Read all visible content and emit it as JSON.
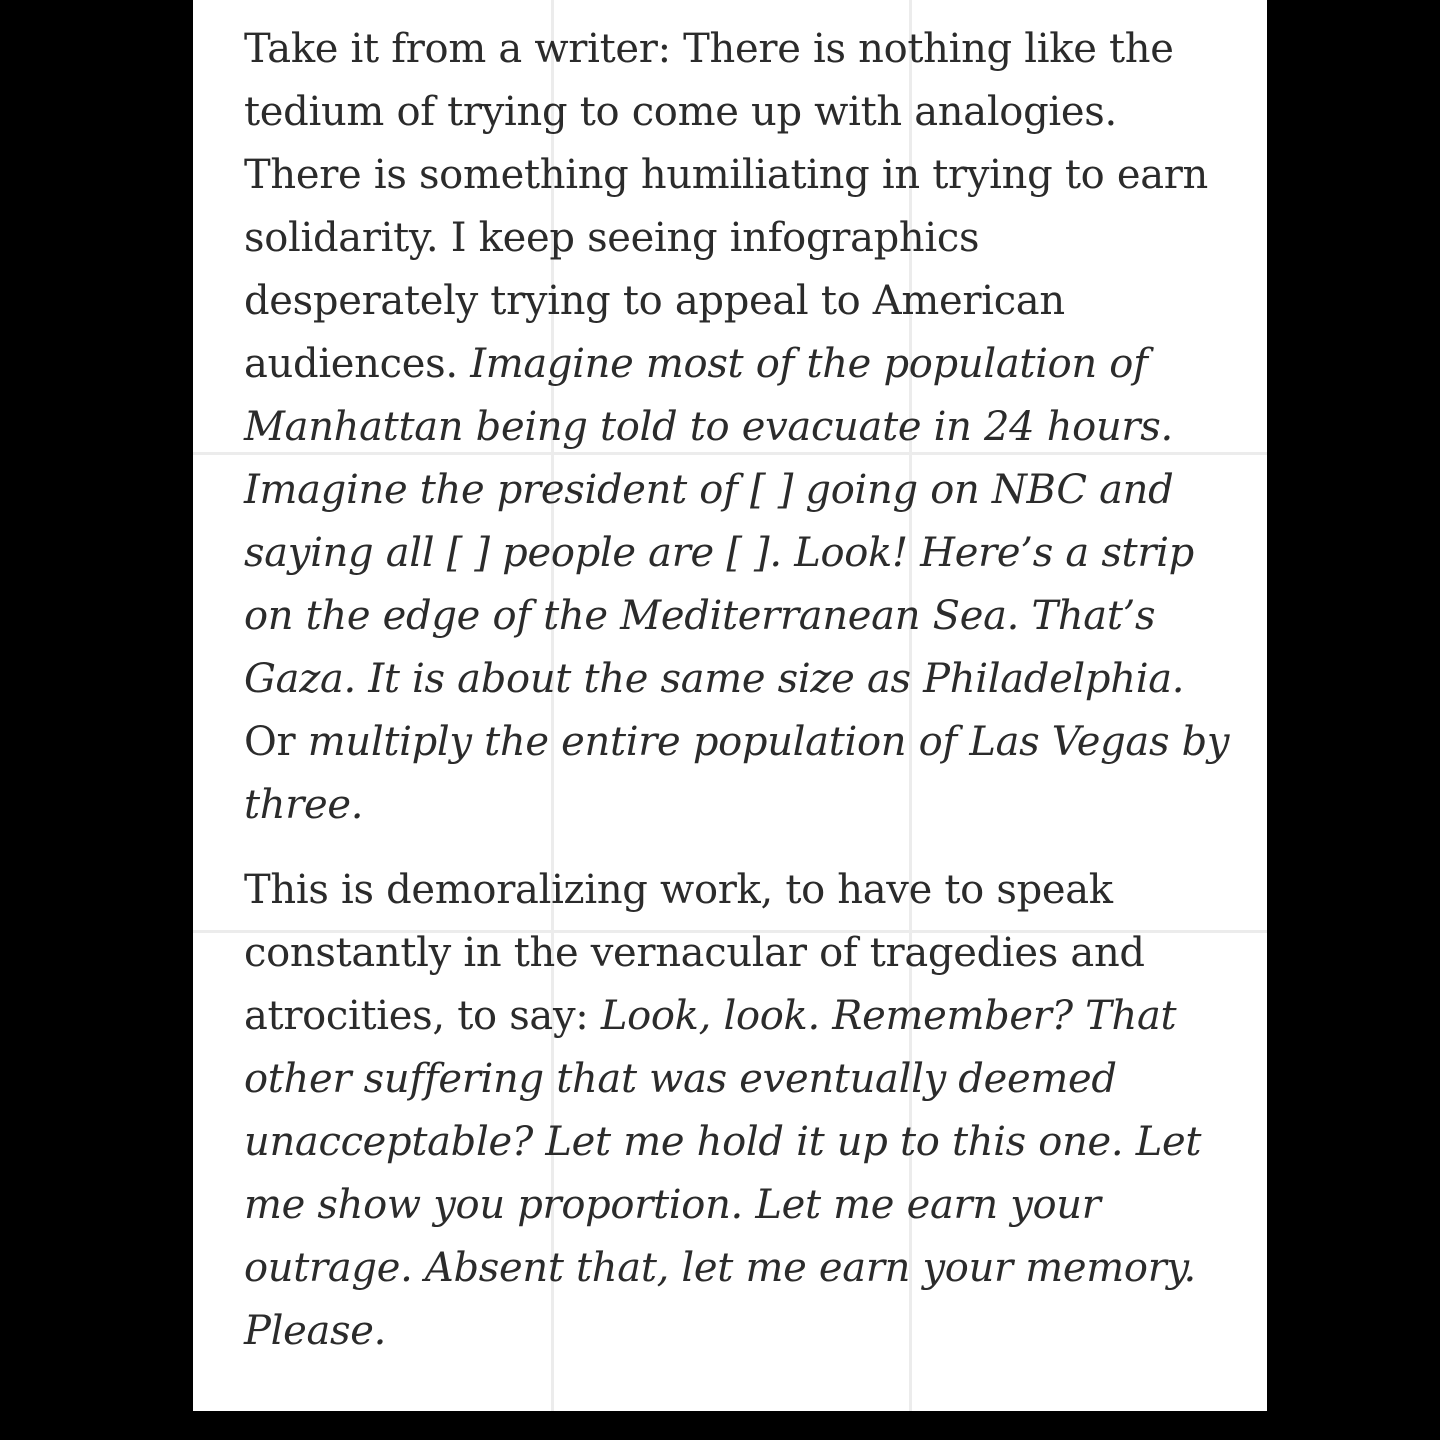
{
  "article": {
    "paragraphs": [
      {
        "lines": [
          [
            {
              "text": "Take it from a writer: There is nothing like the",
              "italic": false
            }
          ],
          [
            {
              "text": "tedium of trying to come up with analogies.",
              "italic": false
            }
          ],
          [
            {
              "text": "There is something humiliating in trying to earn",
              "italic": false
            }
          ],
          [
            {
              "text": "solidarity. I keep seeing infographics",
              "italic": false
            }
          ],
          [
            {
              "text": "desperately trying to appeal to American",
              "italic": false
            }
          ],
          [
            {
              "text": "audiences. ",
              "italic": false
            },
            {
              "text": "Imagine most of the population of",
              "italic": true
            }
          ],
          [
            {
              "text": "Manhattan being told to evacuate in 24 hours.",
              "italic": true
            }
          ],
          [
            {
              "text": "Imagine the president of [ ] going on NBC and",
              "italic": true
            }
          ],
          [
            {
              "text": "saying all [ ] people are [ ]. Look! Here’s a strip",
              "italic": true
            }
          ],
          [
            {
              "text": "on the edge of the Mediterranean Sea. That’s",
              "italic": true
            }
          ],
          [
            {
              "text": "Gaza. It is about the same size as Philadelphia.",
              "italic": true
            }
          ],
          [
            {
              "text": "Or ",
              "italic": false
            },
            {
              "text": "multiply the entire population of Las Vegas by",
              "italic": true
            }
          ],
          [
            {
              "text": "three.",
              "italic": true
            }
          ]
        ]
      },
      {
        "lines": [
          [
            {
              "text": "This is demoralizing work, to have to speak",
              "italic": false
            }
          ],
          [
            {
              "text": "constantly in the vernacular of tragedies and",
              "italic": false
            }
          ],
          [
            {
              "text": "atrocities, to say: ",
              "italic": false
            },
            {
              "text": "Look, look. Remember? That",
              "italic": true
            }
          ],
          [
            {
              "text": "other suffering that was eventually deemed",
              "italic": true
            }
          ],
          [
            {
              "text": "unacceptable? Let me hold it up to this one. Let",
              "italic": true
            }
          ],
          [
            {
              "text": "me show you proportion. Let me earn your",
              "italic": true
            }
          ],
          [
            {
              "text": "outrage. Absent that, let me earn your memory.",
              "italic": true
            }
          ],
          [
            {
              "text": "Please.",
              "italic": true
            }
          ]
        ]
      }
    ]
  }
}
